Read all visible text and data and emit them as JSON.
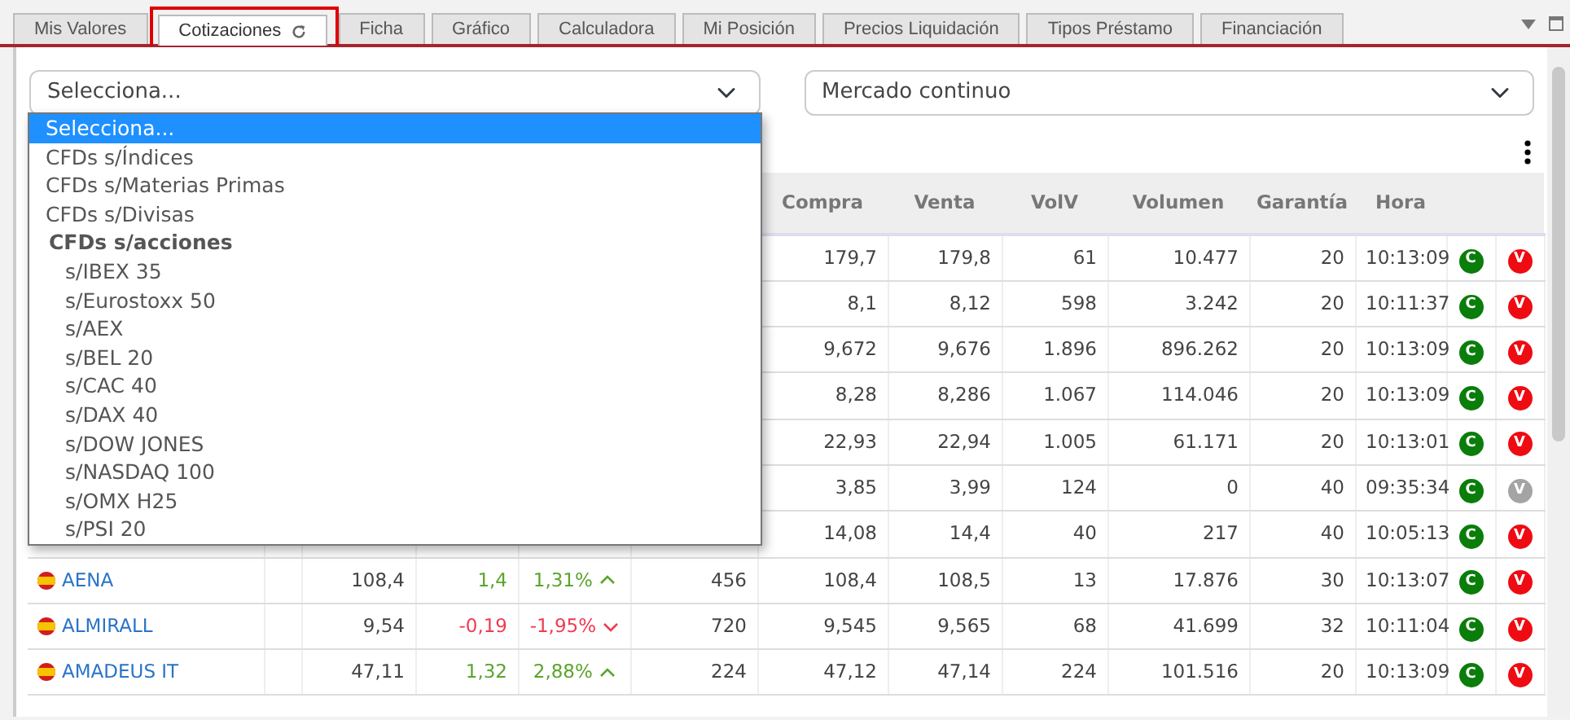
{
  "tabs": [
    {
      "label": "Mis Valores",
      "selected": false,
      "highlighted": false,
      "refresh": false
    },
    {
      "label": "Cotizaciones",
      "selected": true,
      "highlighted": true,
      "refresh": true
    },
    {
      "label": "Ficha",
      "selected": false,
      "highlighted": false,
      "refresh": false
    },
    {
      "label": "Gráfico",
      "selected": false,
      "highlighted": false,
      "refresh": false
    },
    {
      "label": "Calculadora",
      "selected": false,
      "highlighted": false,
      "refresh": false
    },
    {
      "label": "Mi Posición",
      "selected": false,
      "highlighted": false,
      "refresh": false
    },
    {
      "label": "Precios Liquidación",
      "selected": false,
      "highlighted": false,
      "refresh": false
    },
    {
      "label": "Tipos Préstamo",
      "selected": false,
      "highlighted": false,
      "refresh": false
    },
    {
      "label": "Financiación",
      "selected": false,
      "highlighted": false,
      "refresh": false
    }
  ],
  "filters": {
    "product_select": {
      "value": "Selecciona...",
      "expanded": true,
      "options": [
        {
          "kind": "option",
          "label": "Selecciona...",
          "selected": true
        },
        {
          "kind": "option",
          "label": "CFDs s/Índices",
          "selected": false
        },
        {
          "kind": "option",
          "label": "CFDs s/Materias Primas",
          "selected": false
        },
        {
          "kind": "option",
          "label": "CFDs s/Divisas",
          "selected": false
        },
        {
          "kind": "group",
          "label": "CFDs s/acciones",
          "children": [
            {
              "kind": "option",
              "label": "s/IBEX 35",
              "selected": false
            },
            {
              "kind": "option",
              "label": "s/Eurostoxx 50",
              "selected": false
            },
            {
              "kind": "option",
              "label": "s/AEX",
              "selected": false
            },
            {
              "kind": "option",
              "label": "s/BEL 20",
              "selected": false
            },
            {
              "kind": "option",
              "label": "s/CAC 40",
              "selected": false
            },
            {
              "kind": "option",
              "label": "s/DAX 40",
              "selected": false
            },
            {
              "kind": "option",
              "label": "s/DOW JONES",
              "selected": false
            },
            {
              "kind": "option",
              "label": "s/NASDAQ 100",
              "selected": false
            },
            {
              "kind": "option",
              "label": "s/OMX H25",
              "selected": false
            },
            {
              "kind": "option",
              "label": "s/PSI 20",
              "selected": false
            }
          ]
        }
      ]
    },
    "market_select": {
      "value": "Mercado continuo"
    }
  },
  "table": {
    "columns": [
      "Compra",
      "Venta",
      "VolV",
      "Volumen",
      "Garantía",
      "Hora"
    ],
    "rows": [
      {
        "compra": "179,7",
        "venta": "179,8",
        "volv": "61",
        "volumen": "10.477",
        "garantia": "20",
        "hora": "10:13:09",
        "buy": {
          "label": "C",
          "enabled": true
        },
        "sell": {
          "label": "V",
          "enabled": true
        }
      },
      {
        "compra": "8,1",
        "venta": "8,12",
        "volv": "598",
        "volumen": "3.242",
        "garantia": "20",
        "hora": "10:11:37",
        "buy": {
          "label": "C",
          "enabled": true
        },
        "sell": {
          "label": "V",
          "enabled": true
        }
      },
      {
        "compra": "9,672",
        "venta": "9,676",
        "volv": "1.896",
        "volumen": "896.262",
        "garantia": "20",
        "hora": "10:13:09",
        "buy": {
          "label": "C",
          "enabled": true
        },
        "sell": {
          "label": "V",
          "enabled": true
        }
      },
      {
        "compra": "8,28",
        "venta": "8,286",
        "volv": "1.067",
        "volumen": "114.046",
        "garantia": "20",
        "hora": "10:13:09",
        "buy": {
          "label": "C",
          "enabled": true
        },
        "sell": {
          "label": "V",
          "enabled": true
        }
      },
      {
        "compra": "22,93",
        "venta": "22,94",
        "volv": "1.005",
        "volumen": "61.171",
        "garantia": "20",
        "hora": "10:13:01",
        "buy": {
          "label": "C",
          "enabled": true
        },
        "sell": {
          "label": "V",
          "enabled": true
        }
      },
      {
        "compra": "3,85",
        "venta": "3,99",
        "volv": "124",
        "volumen": "0",
        "garantia": "40",
        "hora": "09:35:34",
        "buy": {
          "label": "C",
          "enabled": true
        },
        "sell": {
          "label": "V",
          "enabled": false
        }
      },
      {
        "compra": "14,08",
        "venta": "14,4",
        "volv": "40",
        "volumen": "217",
        "garantia": "40",
        "hora": "10:05:13",
        "buy": {
          "label": "C",
          "enabled": true
        },
        "sell": {
          "label": "V",
          "enabled": true
        }
      },
      {
        "name": "AENA",
        "last": "108,4",
        "change": "1,4",
        "pct": "1,31%",
        "rising": true,
        "volc": "456",
        "compra": "108,4",
        "venta": "108,5",
        "volv": "13",
        "volumen": "17.876",
        "garantia": "30",
        "hora": "10:13:07",
        "buy": {
          "label": "C",
          "enabled": true
        },
        "sell": {
          "label": "V",
          "enabled": true
        }
      },
      {
        "name": "ALMIRALL",
        "last": "9,54",
        "change": "-0,19",
        "pct": "-1,95%",
        "rising": false,
        "volc": "720",
        "compra": "9,545",
        "venta": "9,565",
        "volv": "68",
        "volumen": "41.699",
        "garantia": "32",
        "hora": "10:11:04",
        "buy": {
          "label": "C",
          "enabled": true
        },
        "sell": {
          "label": "V",
          "enabled": true
        }
      },
      {
        "name": "AMADEUS IT",
        "last": "47,11",
        "change": "1,32",
        "pct": "2,88%",
        "rising": true,
        "volc": "224",
        "compra": "47,12",
        "venta": "47,14",
        "volv": "224",
        "volumen": "101.516",
        "garantia": "20",
        "hora": "10:13:09",
        "buy": {
          "label": "C",
          "enabled": true
        },
        "sell": {
          "label": "V",
          "enabled": true
        }
      }
    ]
  }
}
